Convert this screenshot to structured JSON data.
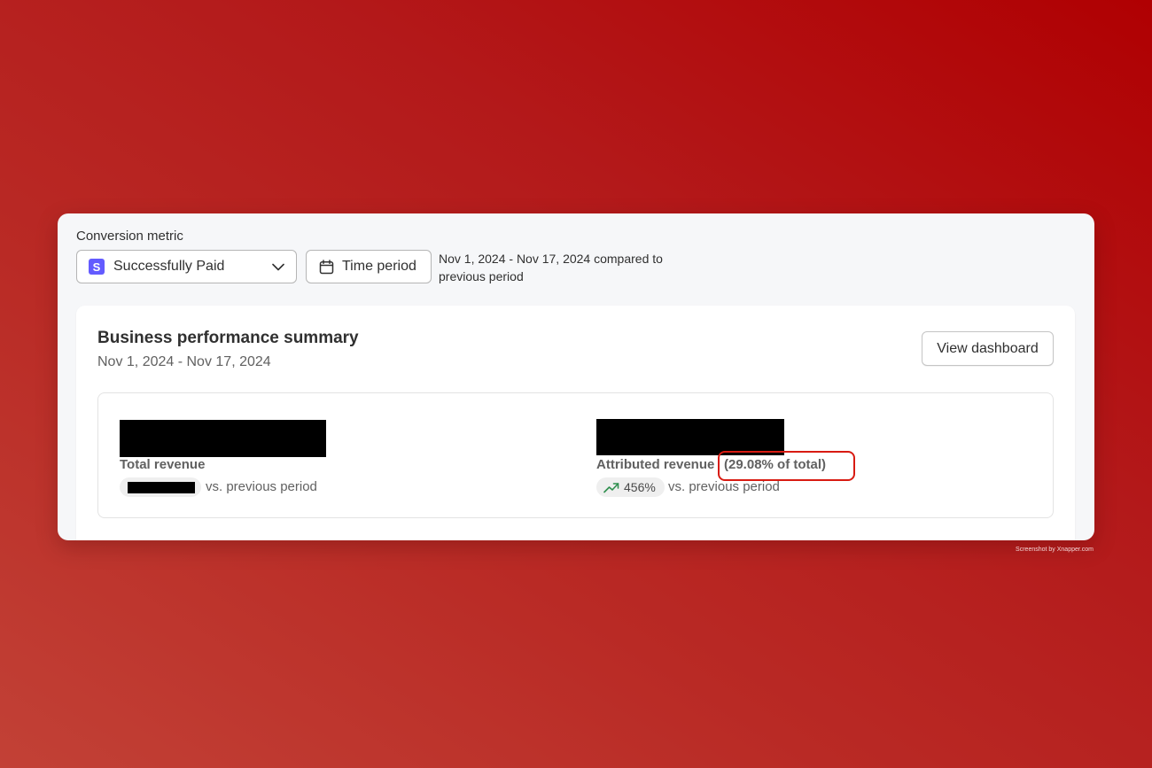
{
  "filters": {
    "metric_label": "Conversion metric",
    "metric_value": "Successfully Paid",
    "metric_icon": "stripe-s-icon",
    "metric_icon_glyph": "S",
    "time_period_label": "Time period",
    "date_range_note": "Nov 1, 2024 - Nov 17, 2024 compared to previous period"
  },
  "summary": {
    "title": "Business performance summary",
    "date_range": "Nov 1, 2024 - Nov 17, 2024",
    "view_dashboard_label": "View dashboard"
  },
  "stats": {
    "total_revenue": {
      "label": "Total revenue",
      "value_redacted": true,
      "change_redacted": true,
      "comparison": "vs. previous period"
    },
    "attributed_revenue": {
      "label": "Attributed revenue",
      "share": "(29.08% of total)",
      "value_redacted": true,
      "change": "456%",
      "trend_icon": "trending-up-icon",
      "comparison": "vs. previous period"
    }
  },
  "colors": {
    "stripe_brand": "#635bff",
    "highlight": "#d81b12",
    "trend_up": "#2f8f4e"
  },
  "watermark": "Screenshot by Xnapper.com"
}
